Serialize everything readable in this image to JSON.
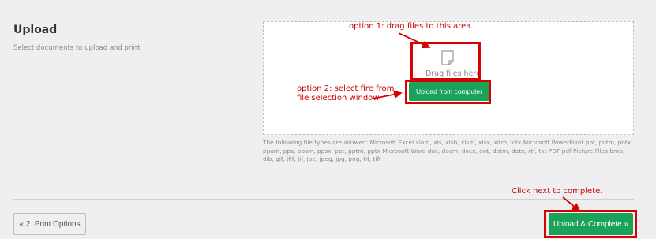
{
  "upload": {
    "title": "Upload",
    "description": "Select documents to upload and print",
    "drag_text": "Drag files here",
    "upload_button_label": "Upload from computer",
    "file_types_text": "The following file types are allowed: Microsoft Excel xlam, xls, xlsb, xlsm, xlsx, xltm, xltx Microsoft PowerPoint pot, potm, potx, ppam, pps, ppsm, ppsx, ppt, pptm, pptx Microsoft Word doc, docm, docx, dot, dotm, dotx, rtf, txt PDF pdf Picture Files bmp, dib, gif, jfif, jif, jpe, jpeg, jpg, png, tif, tiff"
  },
  "annotations": {
    "option1": "option 1: drag files to this area.",
    "option2_line1": "option 2: select fire from",
    "option2_line2": "file selection window",
    "complete_hint": "Click next to complete."
  },
  "footer": {
    "back_label": "« 2. Print Options",
    "complete_label": "Upload & Complete »"
  },
  "colors": {
    "accent_green": "#1aa15a",
    "annotation_red": "#d80000",
    "background": "#efeff1"
  },
  "icons": {
    "file": "file-icon"
  }
}
